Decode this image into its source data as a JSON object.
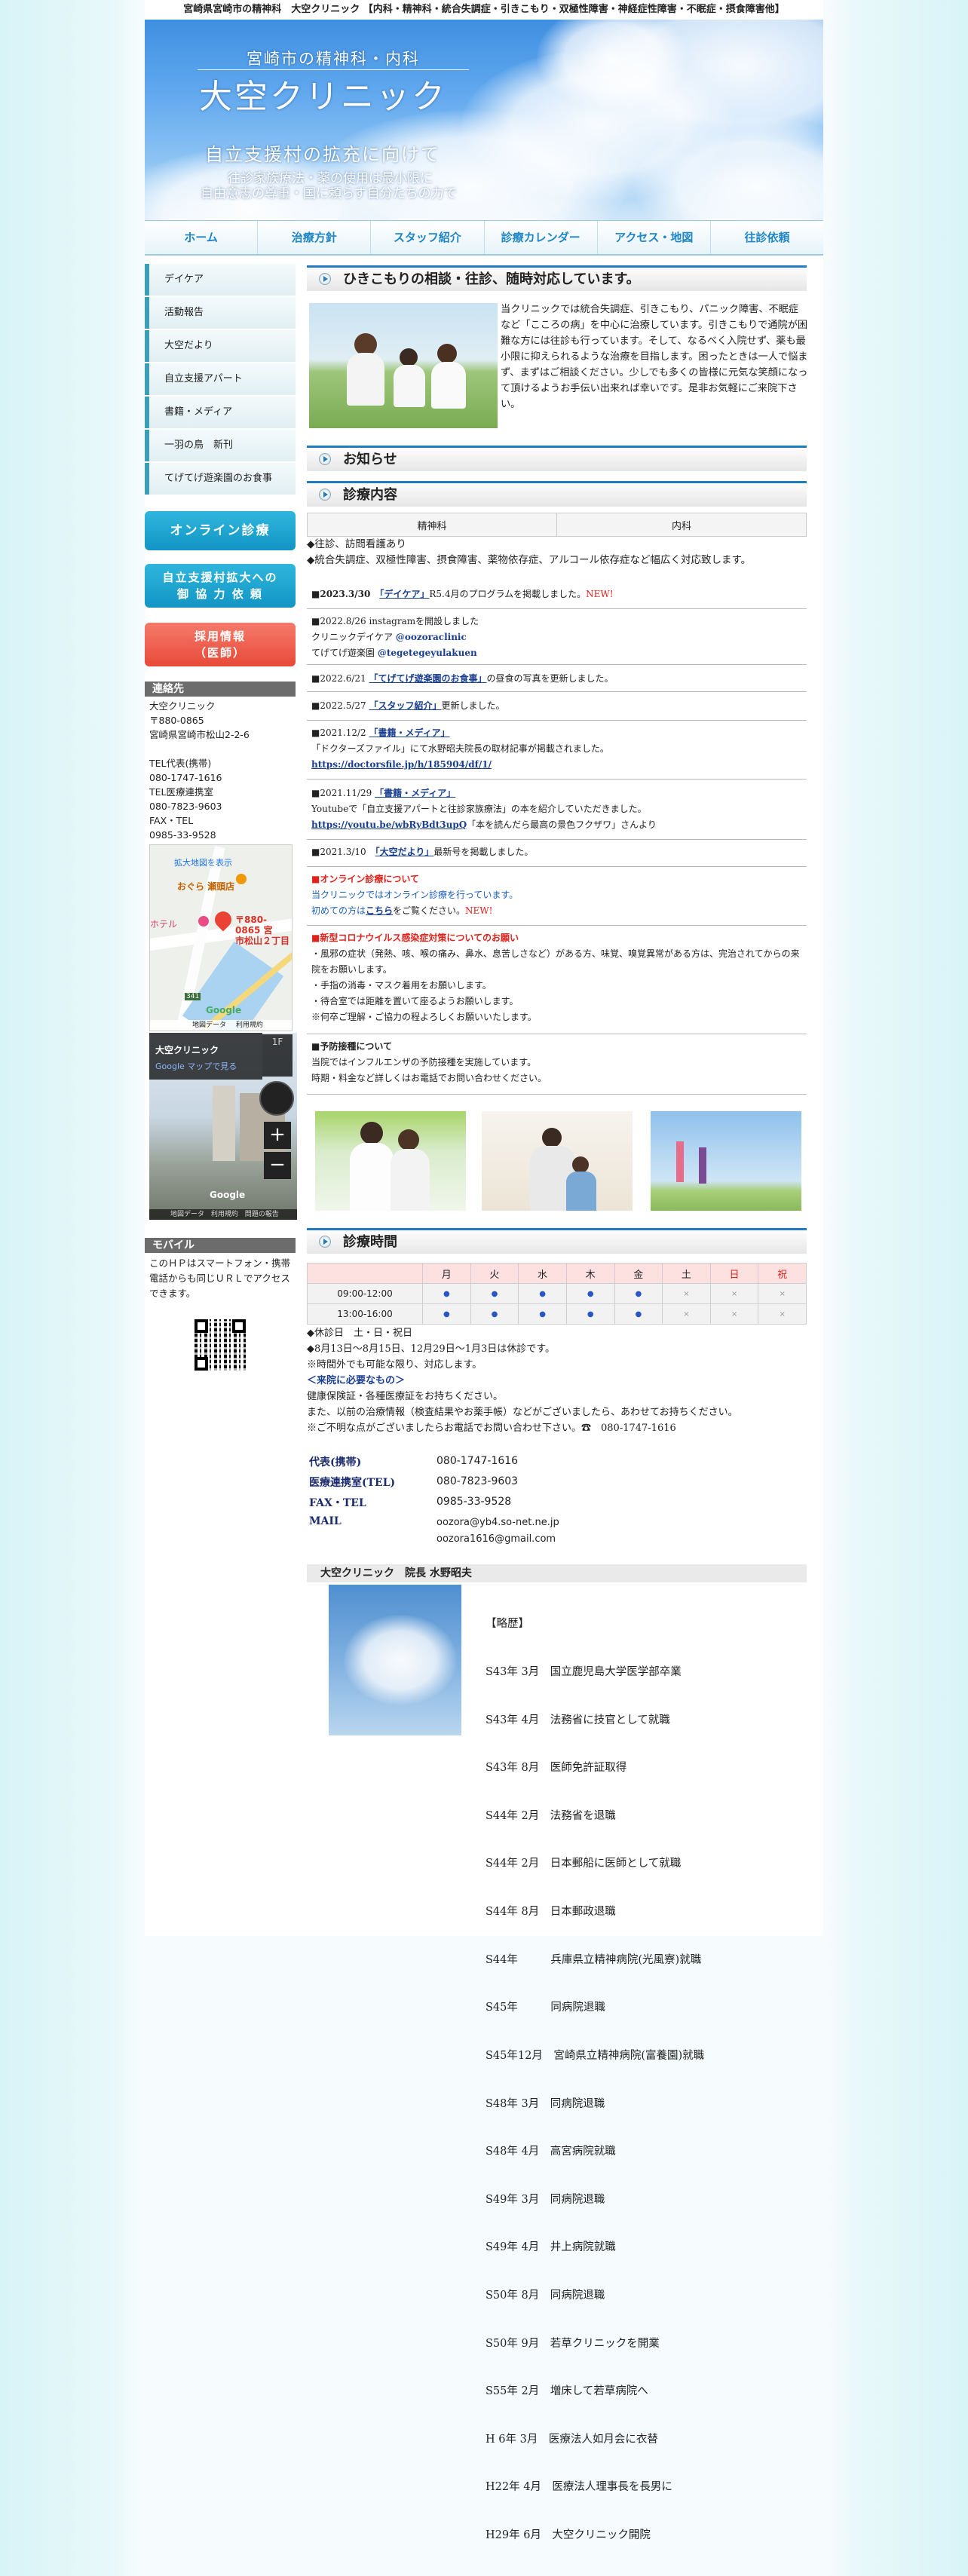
{
  "top_title": "宮崎県宮崎市の精神科　大空クリニック 【内科・精神科・統合失調症・引きこもり・双極性障害・神経症性障害・不眠症・摂食障害他】",
  "header": {
    "subtitle": "宮崎市の精神科・内科",
    "title": "大空クリニック",
    "slogan": "自立支援村の拡充に向けて",
    "line1": "往診家族療法・薬の使用は最小限に",
    "line2": "自由意志の尊重・国に頼らず自分たちの力で"
  },
  "nav": [
    "ホーム",
    "治療方針",
    "スタッフ紹介",
    "診療カレンダー",
    "アクセス・地図",
    "往診依頼"
  ],
  "sidebar": {
    "menu": [
      "デイケア",
      "活動報告",
      "大空だより",
      "自立支援アパート",
      "書籍・メディア",
      "一羽の鳥　新刊",
      "てげてげ遊楽園のお食事"
    ],
    "online_btn": "オンライン診療",
    "coop_btn_line1": "自立支援村拡大への",
    "coop_btn_line2": "御 協 力 依 頼",
    "recruit_btn_line1": "採用情報",
    "recruit_btn_line2": "（医師）",
    "contact_head": "連絡先",
    "contact_lines": [
      "大空クリニック",
      "〒880-0865",
      "宮崎県宮崎市松山2-2-6",
      "",
      "TEL代表(携帯)",
      "080-1747-1616",
      "TEL医療連携室",
      "080-7823-9603",
      "FAX・TEL",
      "0985-33-9528"
    ],
    "map": {
      "enlarge": "拡大地図を表示",
      "poi1": "おぐら 瀬頭店",
      "poi2": "ホテル",
      "pin_line1": "〒880-0865 宮",
      "pin_line2": "市松山２丁目",
      "road": "341",
      "google": "Google",
      "footer1": "地図データ",
      "footer2": "利用規約"
    },
    "streetview": {
      "name": "大空クリニック",
      "link": "Google マップで見る",
      "floor": "1F",
      "google": "Google",
      "footer1": "地図データ",
      "footer2": "利用規約",
      "footer3": "問題の報告"
    },
    "mobile_head": "モバイル",
    "mobile_text": "このＨＰはスマートフォン・携帯電話からも同じＵＲＬでアクセスできます。"
  },
  "intro": {
    "heading": "ひきこもりの相談・往診、随時対応しています。",
    "text": "当クリニックでは統合失調症、引きこもり、パニック障害、不眠症など「こころの病」を中心に治療しています。引きこもりで通院が困難な方には往診も行っています。そして、なるべく入院せず、薬も最小限に抑えられるような治療を目指します。困ったときは一人で悩まず、まずはご相談ください。少しでも多くの皆様に元気な笑顔になって頂けるようお手伝い出来れば幸いです。是非お気軽にご来院下さい。"
  },
  "notice_heading": "お知らせ",
  "clinic": {
    "heading": "診療内容",
    "col1": "精神科",
    "col2": "内科",
    "line1": "◆往診、訪問看護あり",
    "line2": "◆統合失調症、双極性障害、摂食障害、薬物依存症、アルコール依存症など幅広く対応致します。"
  },
  "news": {
    "n1_date": "■2023.3/30",
    "n1_link": "「デイケア」",
    "n1_text": "R5.4月のプログラムを掲載しました。",
    "new": "NEW!",
    "n2_line1": "■2022.8/26 instagramを開設しました",
    "n2_line2a": "クリニックデイケア",
    "n2_line2b": "@oozoraclinic",
    "n2_line3a": "てげてげ遊楽園",
    "n2_line3b": "@tegetegeyulakuen",
    "n3_date": "■2022.6/21",
    "n3_link": "「てげてげ遊楽園のお食事」",
    "n3_text": "の昼食の写真を更新しました。",
    "n4_date": "■2022.5/27",
    "n4_link": "「スタッフ紹介」",
    "n4_text": "更新しました。",
    "n5_date": "■2021.12/2",
    "n5_link": "「書籍・メディア」",
    "n5_line2": "「ドクターズファイル」にて水野昭夫院長の取材記事が掲載されました。",
    "n5_url": "https://doctorsfile.jp/h/185904/df/1/",
    "n6_date": "■2021.11/29",
    "n6_link": "「書籍・メディア」",
    "n6_line2": "Youtubeで「自立支援アパートと往診家族療法」の本を紹介していただきました。",
    "n6_url": "https://youtu.be/wbRyBdt3upQ",
    "n6_after": "「本を読んだら最高の景色フクザワ」さんより",
    "n7_date": "■2021.3/10",
    "n7_link": "「大空だより」",
    "n7_text": "最新号を掲載しました。",
    "online_head": "■オンライン診療について",
    "online_l1": "当クリニックではオンライン診療を行っています。",
    "online_l2a": "初めての方は",
    "online_l2b": "こちら",
    "online_l2c": "をご覧ください。",
    "covid_head": "■新型コロナウイルス感染症対策についてのお願い",
    "covid_l1": "・風邪の症状（発熱、咳、喉の痛み、鼻水、息苦しさなど）がある方、味覚、嗅覚異常がある方は、完治されてからの来院をお願いします。",
    "covid_l2": "・手指の消毒・マスク着用をお願いします。",
    "covid_l3": "・待合室では距離を置いて座るようお願いします。",
    "covid_l4": "※何卒ご理解・ご協力の程よろしくお願いいたします。",
    "vac_head": "■予防接種について",
    "vac_l1": "当院ではインフルエンザの予防接種を実施しています。",
    "vac_l2": "時期・料金など詳しくはお電話でお問い合わせください。"
  },
  "hours": {
    "heading": "診療時間",
    "days": [
      "月",
      "火",
      "水",
      "木",
      "金",
      "土",
      "日",
      "祝"
    ],
    "rows": [
      {
        "time": "09:00-12:00",
        "marks": [
          "●",
          "●",
          "●",
          "●",
          "●",
          "×",
          "×",
          "×"
        ]
      },
      {
        "time": "13:00-16:00",
        "marks": [
          "●",
          "●",
          "●",
          "●",
          "●",
          "×",
          "×",
          "×"
        ]
      }
    ],
    "holiday": "◆休診日　土・日・祝日",
    "holiday2": "◆8月13日～8月15日、12月29日～1月3日は休診です。",
    "note": "※時間外でも可能な限り、対応します。",
    "bring_head": "＜来院に必要なもの＞",
    "bring1": "健康保険証・各種医療証をお持ちください。",
    "bring2": "また、以前の治療情報（検査結果やお薬手帳）などがございましたら、あわせてお持ちください。",
    "bring3": "※ご不明な点がございましたらお電話でお問い合わせ下さい。☎　080-1747-1616"
  },
  "contacts": [
    {
      "label": "代表(携帯)",
      "value": "080-1747-1616"
    },
    {
      "label": "医療連携室(TEL)",
      "value": "080-7823-9603"
    },
    {
      "label": "FAX・TEL",
      "value": "0985-33-9528"
    },
    {
      "label": "MAIL",
      "value": "oozora@yb4.so-net.ne.jp",
      "value2": "oozora1616@gmail.com"
    }
  ],
  "director": {
    "heading": "大空クリニック　院長 水野昭夫",
    "career_title": "【略歴】",
    "career": [
      "S43年 3月　国立鹿児島大学医学部卒業",
      "S43年 4月　法務省に技官として就職",
      "S43年 8月　医師免許証取得",
      "S44年 2月　法務省を退職",
      "S44年 2月　日本郵船に医師として就職",
      "S44年 8月　日本郵政退職",
      "S44年　　　兵庫県立精神病院(光風寮)就職",
      "S45年　　　同病院退職",
      "S45年12月　宮崎県立精神病院(富養園)就職",
      "S48年 3月　同病院退職",
      "S48年 4月　高宮病院就職",
      "S49年 3月　同病院退職",
      "S49年 4月　井上病院就職",
      "S50年 8月　同病院退職",
      "S50年 9月　若草クリニックを開業",
      "S55年 2月　増床して若草病院へ",
      "H 6年 3月　医療法人如月会に衣替",
      "H22年 4月　医療法人理事長を長男に",
      "H29年 6月　大空クリニック開院"
    ]
  },
  "colors": {
    "accent": "#1e86c7",
    "online_btn": "#1aa3cf",
    "recruit_btn": "#ee5a4a",
    "new": "#e0221b",
    "heading_border": "#1f7cc2"
  }
}
